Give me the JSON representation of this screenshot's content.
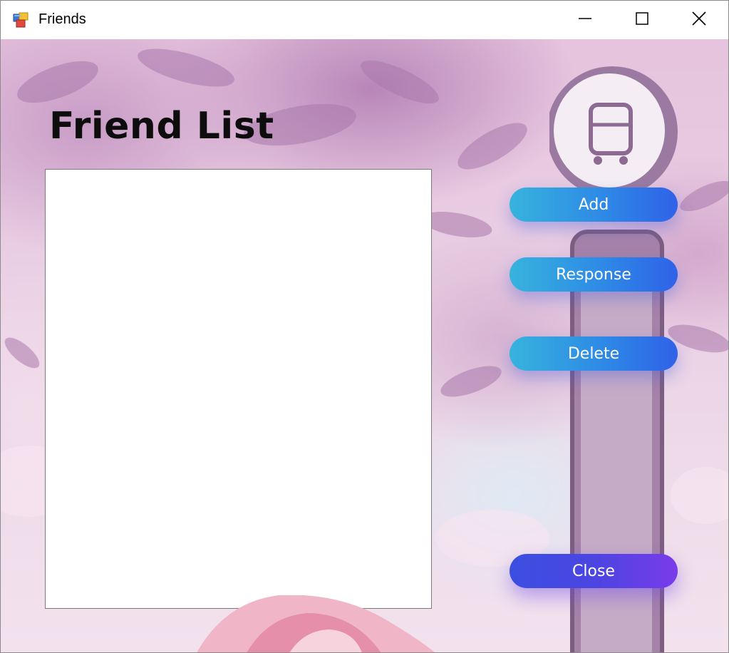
{
  "window": {
    "title": "Friends",
    "app_icon": "windows-form-icon",
    "controls": {
      "minimize_icon": "minimize-icon",
      "maximize_icon": "maximize-icon",
      "close_icon": "close-icon"
    }
  },
  "main": {
    "heading": "Friend List",
    "friend_list": [],
    "buttons": {
      "add": "Add",
      "response": "Response",
      "delete": "Delete",
      "close": "Close"
    }
  },
  "colors": {
    "button_blue_start": "#37b3dd",
    "button_blue_end": "#2f62e8",
    "button_close_start": "#3b4fe0",
    "button_close_end": "#7a3bea"
  }
}
